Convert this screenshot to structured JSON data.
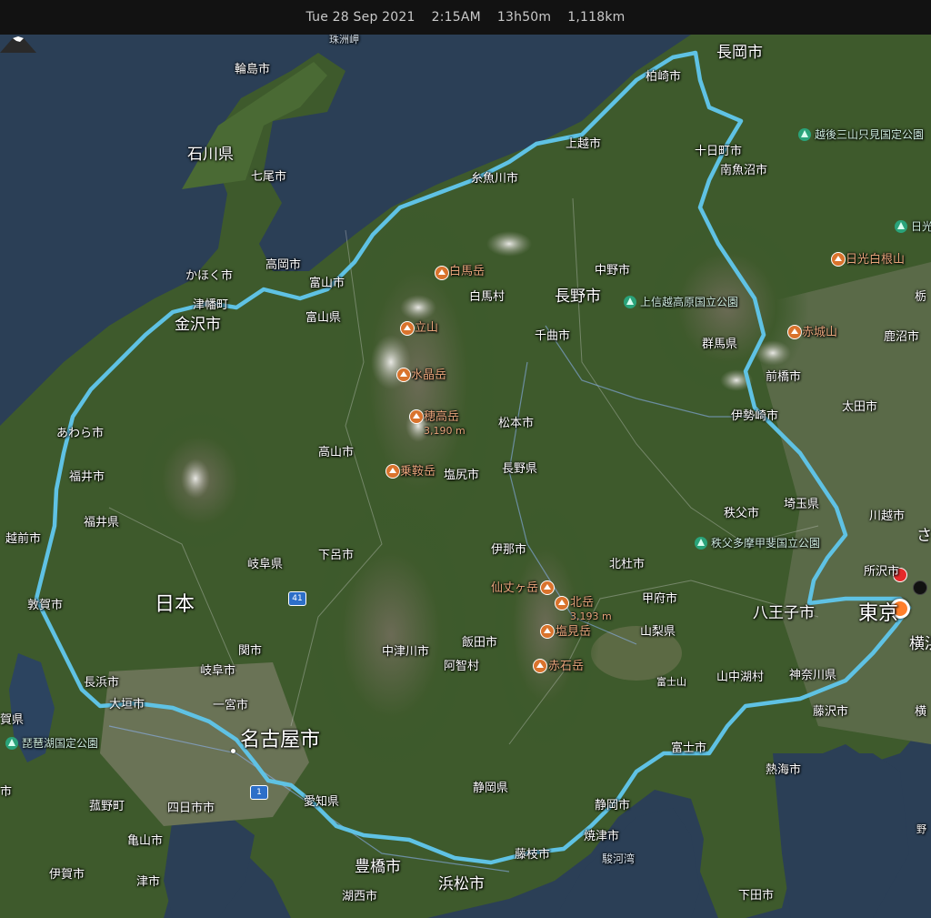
{
  "status_bar": {
    "date": "Tue 28 Sep 2021",
    "time": "2:15AM",
    "duration": "13h50m",
    "distance": "1,118km"
  },
  "colors": {
    "route": "#5fc2e4",
    "sea": "#2b3f56",
    "land": "#3c5a2b",
    "mountain_label": "#e7a57b",
    "marker_end": "#ff7f2a",
    "marker_red": "#e42a2a"
  },
  "icons": {
    "mountain": "mountain-icon",
    "park": "park-icon",
    "route_end": "route-end-marker",
    "fuji": "mount-fuji-icon"
  },
  "map": {
    "cities": {
      "wajima": "輪島市",
      "ishikawa": "石川県",
      "nanao": "七尾市",
      "kahoku": "かほく市",
      "tsubata": "津幡町",
      "kanazawa": "金沢市",
      "takaoka": "高岡市",
      "toyama_city": "富山市",
      "toyama_pref": "富山県",
      "awara": "あわら市",
      "fukui_city": "福井市",
      "fukui_pref": "福井県",
      "echizen": "越前市",
      "tsuruga": "敦賀市",
      "nippon": "日本",
      "nagahama": "長浜市",
      "ogaki": "大垣市",
      "gifu_city": "岐阜市",
      "seki": "関市",
      "gifu_pref": "岐阜県",
      "gero": "下呂市",
      "takayama": "高山市",
      "ichinomiya": "一宮市",
      "nagoya": "名古屋市",
      "aichi": "愛知県",
      "shiga": "賀県",
      "komono": "菰野町",
      "yokkaichi": "四日市市",
      "kameyama": "亀山市",
      "iga": "伊賀市",
      "tsu": "津市",
      "kosai": "湖西市",
      "toyohashi": "豊橋市",
      "hamamatsu": "浜松市",
      "fujieda": "藤枝市",
      "yaizu": "焼津市",
      "suruga_bay": "駿河湾",
      "shizuoka_city": "静岡市",
      "shizuoka_pref": "静岡県",
      "fuji_city": "富士市",
      "fujisan": "富士山",
      "atami": "熱海市",
      "shimoda": "下田市",
      "fujisawa": "藤沢市",
      "kanagawa": "神奈川県",
      "yamanakako": "山中湖村",
      "hachioji": "八王子市",
      "tokyo": "東京",
      "yokohama": "横浜",
      "tokorozawa": "所沢市",
      "kawagoe": "川越市",
      "saitama_partial": "さい",
      "saitama_pref": "埼玉県",
      "chichibu": "秩父市",
      "kofu": "甲府市",
      "yamanashi": "山梨県",
      "hokuto": "北杜市",
      "ina": "伊那市",
      "iida": "飯田市",
      "achi": "阿智村",
      "nakatsugawa": "中津川市",
      "shiojiri": "塩尻市",
      "matsumoto": "松本市",
      "nagano_pref": "長野県",
      "nagano_city": "長野市",
      "chikuma": "千曲市",
      "nakano": "中野市",
      "hakuba": "白馬村",
      "itoigawa": "糸魚川市",
      "joetsu": "上越市",
      "kashiwazaki": "柏崎市",
      "nagaoka": "長岡市",
      "tokamachi": "十日町市",
      "minamiuonuma": "南魚沼市",
      "gunma": "群馬県",
      "maebashi": "前橋市",
      "isesaki": "伊勢崎市",
      "ota": "太田市",
      "kanuma": "鹿沼市",
      "tochigi_partial": "栃",
      "nikko_partial": "日光"
    },
    "mountains": {
      "shirouma": "白馬岳",
      "tateyama": "立山",
      "suisho": "水晶岳",
      "hotaka": "穂高岳",
      "hotaka_elev": "3,190 m",
      "norikura": "乗鞍岳",
      "senjo": "仙丈ヶ岳",
      "kitadake": "北岳",
      "kitadake_elev": "3,193 m",
      "shiomi": "塩見岳",
      "akaishi": "赤石岳",
      "akagi": "赤城山",
      "nikko_shirane": "日光白根山"
    },
    "parks": {
      "echigo": "越後三山只見国定公園",
      "joshinetsu": "上信越高原国立公園",
      "chichibu_tama": "秩父多摩甲斐国立公園",
      "biwako": "琵琶湖国定公園"
    },
    "misc": {
      "suzu_cape": "珠洲岬",
      "route_41": "41",
      "route_1": "1",
      "noma": "野",
      "kana_partial": "横",
      "shiga_partial": "市"
    }
  }
}
